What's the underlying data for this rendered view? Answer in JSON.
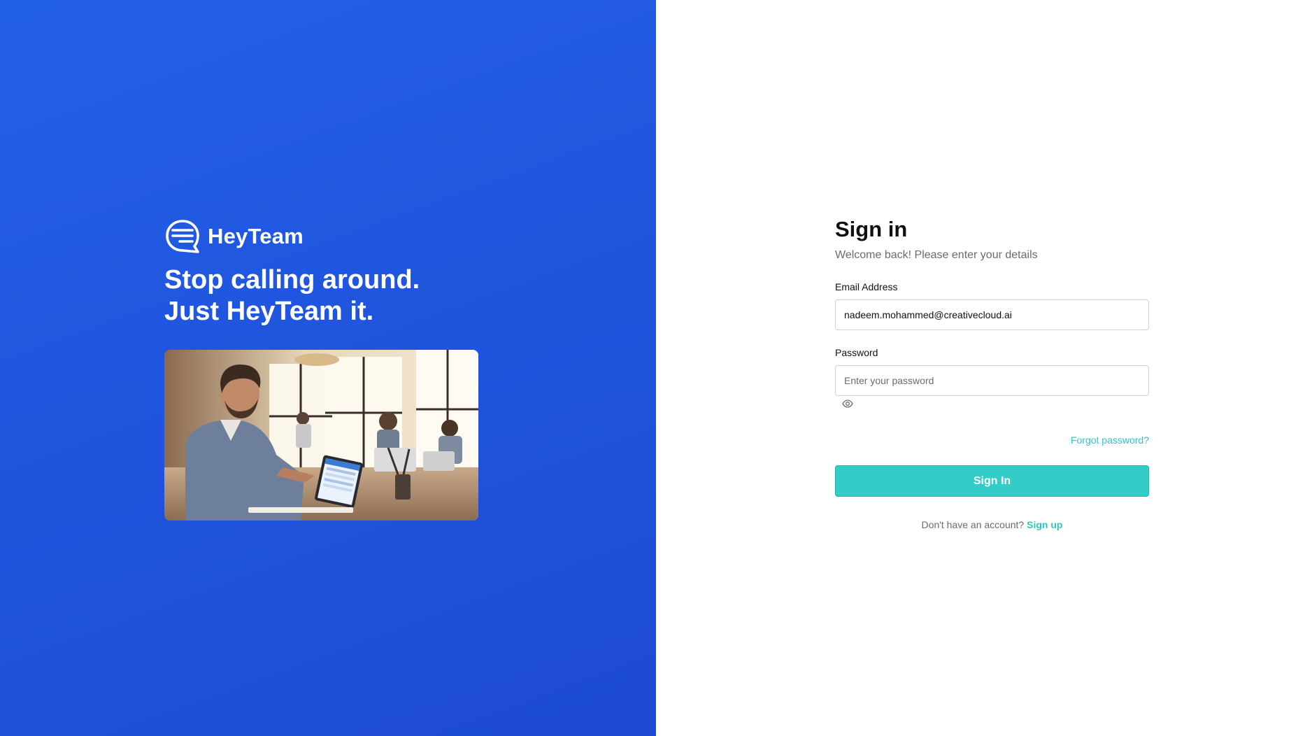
{
  "brand": {
    "name": "HeyTeam",
    "tagline_line1": "Stop calling around.",
    "tagline_line2": "Just HeyTeam it.",
    "logo_icon": "chat-bubble-icon",
    "hero_image": "man-using-tablet-in-office-photo"
  },
  "signin": {
    "title": "Sign in",
    "subtitle": "Welcome back! Please enter your details",
    "email_label": "Email Address",
    "email_value": "nadeem.mohammed@creativecloud.ai",
    "password_label": "Password",
    "password_placeholder": "Enter your password",
    "password_toggle_icon": "eye-icon",
    "forgot_label": "Forgot password?",
    "submit_label": "Sign In",
    "signup_prompt": "Don't have an account?",
    "signup_label": "Sign up"
  },
  "colors": {
    "brand_blue": "#2360e8",
    "accent_teal": "#33ccc6",
    "link_teal": "#30c6c1"
  }
}
